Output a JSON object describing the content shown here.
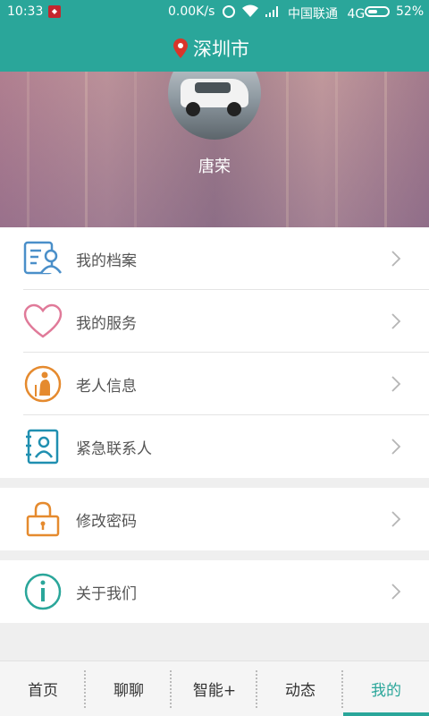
{
  "status_bar": {
    "time": "10:33",
    "network_speed": "0.00K/s",
    "carrier": "中国联通",
    "network_type": "4G",
    "battery_percent": "52%",
    "battery_level": 0.52
  },
  "header": {
    "city": "深圳市",
    "pin_color": "#d9352a"
  },
  "profile": {
    "name": "唐荣"
  },
  "menu_group_1": [
    {
      "label": "我的档案",
      "icon": "profile-card-icon"
    },
    {
      "label": "我的服务",
      "icon": "heart-icon"
    },
    {
      "label": "老人信息",
      "icon": "elderly-person-icon"
    },
    {
      "label": "紧急联系人",
      "icon": "contact-book-icon"
    }
  ],
  "menu_group_2": [
    {
      "label": "修改密码",
      "icon": "lock-icon"
    }
  ],
  "menu_group_3": [
    {
      "label": "关于我们",
      "icon": "info-icon"
    }
  ],
  "tabs": [
    {
      "label": "首页"
    },
    {
      "label": "聊聊"
    },
    {
      "label": "智能+"
    },
    {
      "label": "动态"
    },
    {
      "label": "我的",
      "active": true
    }
  ],
  "colors": {
    "accent": "#2aa69a",
    "text": "#555555"
  }
}
